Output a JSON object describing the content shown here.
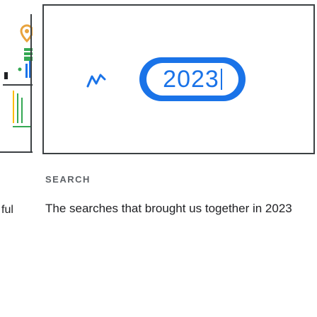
{
  "left_card": {
    "caption": "ful",
    "icons": [
      "location-pin-icon",
      "map-icon",
      "dot-icon",
      "chart-bar-icon"
    ]
  },
  "main_card": {
    "image": {
      "year_text": "2023",
      "accent": "#1a73e8",
      "trend_icon": "trend-line-icon"
    },
    "eyebrow": "SEARCH",
    "headline": "The searches that brought us together in 2023"
  },
  "colors": {
    "border": "#3c4043",
    "text": "#202124",
    "muted": "#5f6368"
  }
}
